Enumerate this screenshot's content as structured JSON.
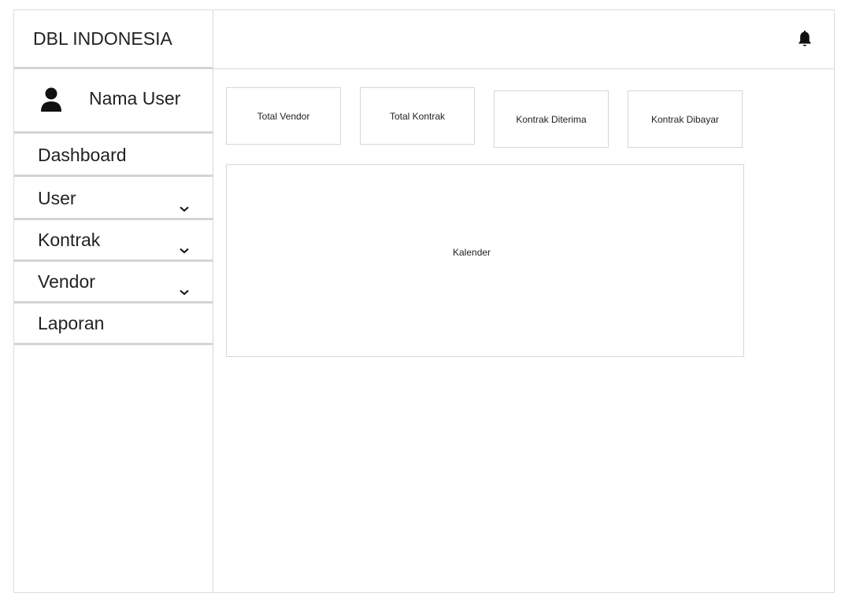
{
  "sidebar": {
    "brand": "DBL INDONESIA",
    "user": {
      "name": "Nama User",
      "icon": "user-icon"
    },
    "items": [
      {
        "label": "Dashboard",
        "has_submenu": false
      },
      {
        "label": "User",
        "has_submenu": true
      },
      {
        "label": "Kontrak",
        "has_submenu": true
      },
      {
        "label": "Vendor",
        "has_submenu": true
      },
      {
        "label": "Laporan",
        "has_submenu": false
      }
    ]
  },
  "topbar": {
    "notification_icon": "bell-icon"
  },
  "cards": [
    {
      "label": "Total Vendor"
    },
    {
      "label": "Total Kontrak"
    },
    {
      "label": "Kontrak Diterima"
    },
    {
      "label": "Kontrak Dibayar"
    }
  ],
  "calendar": {
    "label": "Kalender"
  },
  "colors": {
    "border": "#d4d4d4",
    "text": "#222222",
    "background": "#ffffff"
  }
}
